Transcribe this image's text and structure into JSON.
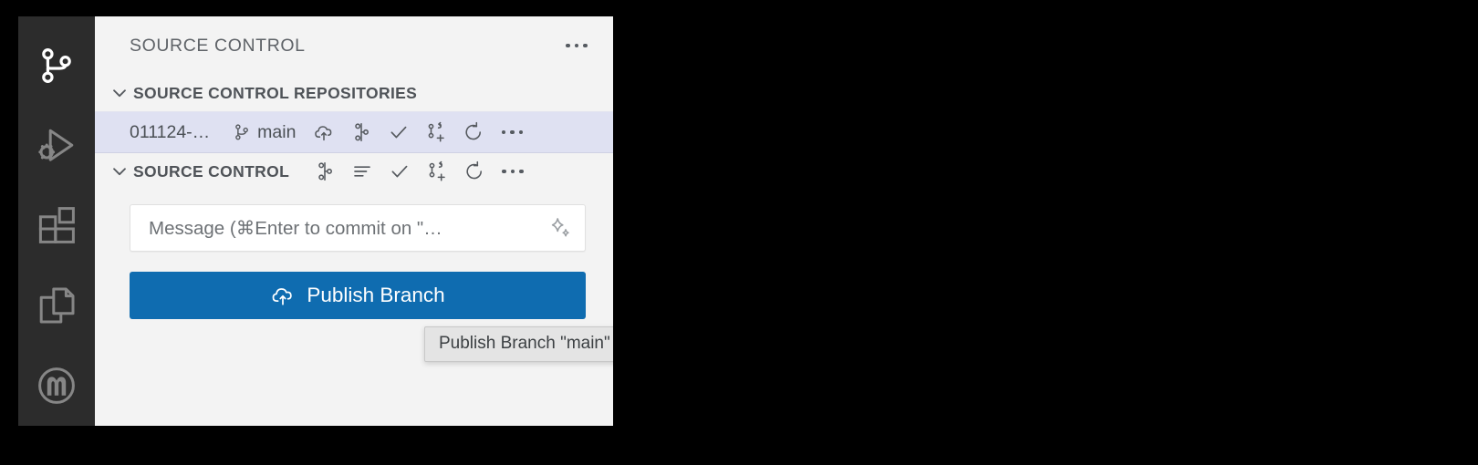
{
  "window": {
    "activity_bar": {
      "items": [
        {
          "name": "source-control",
          "icon": "source-control-icon",
          "active": true
        },
        {
          "name": "run-and-debug",
          "icon": "run-and-debug-icon",
          "active": false
        },
        {
          "name": "extensions",
          "icon": "extensions-icon",
          "active": false
        },
        {
          "name": "copy-files",
          "icon": "copy-files-icon",
          "active": false
        },
        {
          "name": "mulesoft",
          "icon": "mulesoft-logo-icon",
          "active": false
        }
      ]
    },
    "sidebar": {
      "title": "SOURCE CONTROL",
      "title_more_icon": "ellipsis-icon",
      "repositories_section": {
        "title": "SOURCE CONTROL REPOSITORIES",
        "chevron_icon": "chevron-down-icon",
        "repository": {
          "name": "011124-…",
          "branch_icon": "git-branch-icon",
          "branch": "main",
          "actions": [
            {
              "name": "publish-branch",
              "icon": "cloud-upload-icon"
            },
            {
              "name": "source-control",
              "icon": "git-merge-icon"
            },
            {
              "name": "commit",
              "icon": "check-icon"
            },
            {
              "name": "commit-and-push",
              "icon": "git-commit-plus-icon"
            },
            {
              "name": "refresh",
              "icon": "refresh-icon"
            },
            {
              "name": "more-actions",
              "icon": "ellipsis-icon"
            }
          ]
        }
      },
      "source_control_section": {
        "title": "SOURCE CONTROL",
        "chevron_icon": "chevron-down-icon",
        "actions": [
          {
            "name": "source-control",
            "icon": "git-merge-icon"
          },
          {
            "name": "view-as-list",
            "icon": "list-icon"
          },
          {
            "name": "commit",
            "icon": "check-icon"
          },
          {
            "name": "commit-and-push",
            "icon": "git-commit-plus-icon"
          },
          {
            "name": "refresh",
            "icon": "refresh-icon"
          },
          {
            "name": "more-actions",
            "icon": "ellipsis-icon"
          }
        ]
      },
      "commit": {
        "message_placeholder": "Message (⌘Enter to commit on \"…",
        "message_value": "",
        "sparkle_icon": "sparkle-icon",
        "publish_button_label": "Publish Branch",
        "publish_button_icon": "cloud-upload-icon",
        "publish_button_color": "#0f6cb0"
      }
    },
    "tooltip": {
      "text": "Publish Branch \"main\""
    },
    "colors": {
      "activity_bar_bg": "#2c2c2c",
      "sidebar_bg": "#f3f3f3",
      "selected_row_bg": "#dfe1f2",
      "accent": "#0f6cb0"
    }
  }
}
